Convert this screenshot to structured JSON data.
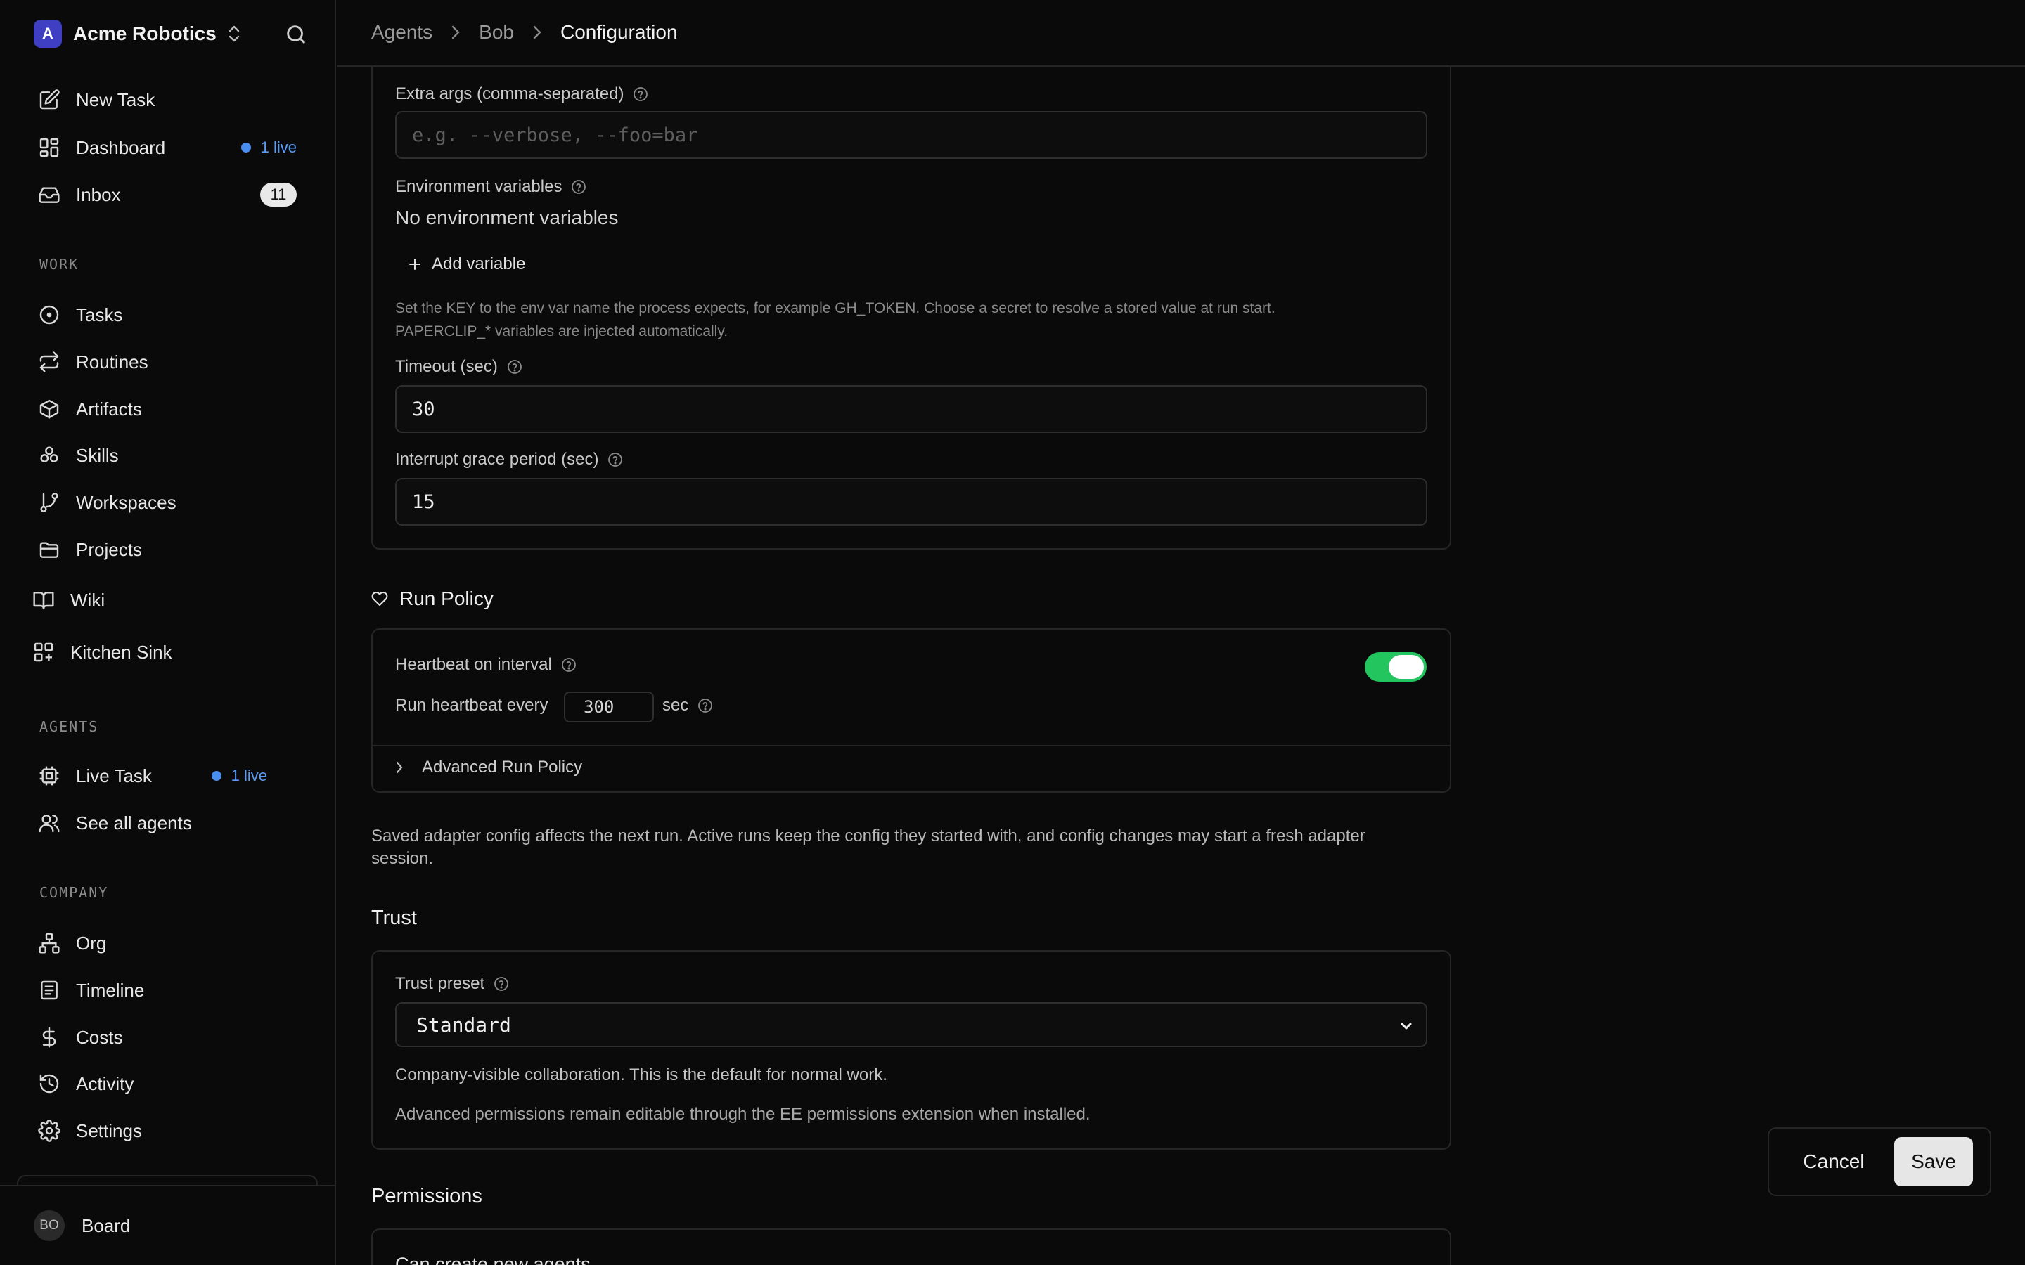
{
  "brand": {
    "logo_letter": "A",
    "name": "Acme Robotics"
  },
  "nav": {
    "new_task": "New Task",
    "dashboard": "Dashboard",
    "dashboard_live": "1 live",
    "inbox": "Inbox",
    "inbox_count": "11"
  },
  "work": {
    "label": "WORK",
    "items": [
      "Tasks",
      "Routines",
      "Artifacts",
      "Skills",
      "Workspaces",
      "Projects",
      "Wiki",
      "Kitchen Sink"
    ]
  },
  "agents": {
    "label": "AGENTS",
    "live_task": "Live Task",
    "live_task_live": "1 live",
    "see_all": "See all agents"
  },
  "company": {
    "label": "COMPANY",
    "items": [
      "Org",
      "Timeline",
      "Costs",
      "Activity",
      "Settings"
    ]
  },
  "user": {
    "initials": "BO",
    "name": "Board"
  },
  "breadcrumb": [
    "Agents",
    "Bob",
    "Configuration"
  ],
  "form": {
    "extra_args_label": "Extra args (comma-separated)",
    "extra_args_placeholder": "e.g. --verbose, --foo=bar",
    "env_label": "Environment variables",
    "env_empty": "No environment variables",
    "add_variable": "Add variable",
    "env_help_1": "Set the KEY to the env var name the process expects, for example GH_TOKEN. Choose a secret to resolve a stored value at run start.",
    "env_help_2": "PAPERCLIP_* variables are injected automatically.",
    "timeout_label": "Timeout (sec)",
    "timeout_value": "30",
    "grace_label": "Interrupt grace period (sec)",
    "grace_value": "15"
  },
  "run_policy": {
    "title": "Run Policy",
    "heartbeat_label": "Heartbeat on interval",
    "heartbeat_enabled": true,
    "interval_prefix": "Run heartbeat every",
    "interval_value": "300",
    "interval_unit": "sec",
    "advanced": "Advanced Run Policy"
  },
  "note": {
    "line1": "Saved adapter config affects the next run. Active runs keep the config they started with, and config changes may start a fresh adapter",
    "line2": "session."
  },
  "trust": {
    "title": "Trust",
    "preset_label": "Trust preset",
    "preset_value": "Standard",
    "description": "Company-visible collaboration. This is the default for normal work.",
    "advanced_note": "Advanced permissions remain editable through the EE permissions extension when installed."
  },
  "permissions": {
    "title": "Permissions",
    "first_item": "Can create new agents"
  },
  "actions": {
    "cancel": "Cancel",
    "save": "Save"
  },
  "colors": {
    "accent": "#22c55e",
    "live": "#4a8df0",
    "brand": "#3f3fc4"
  }
}
